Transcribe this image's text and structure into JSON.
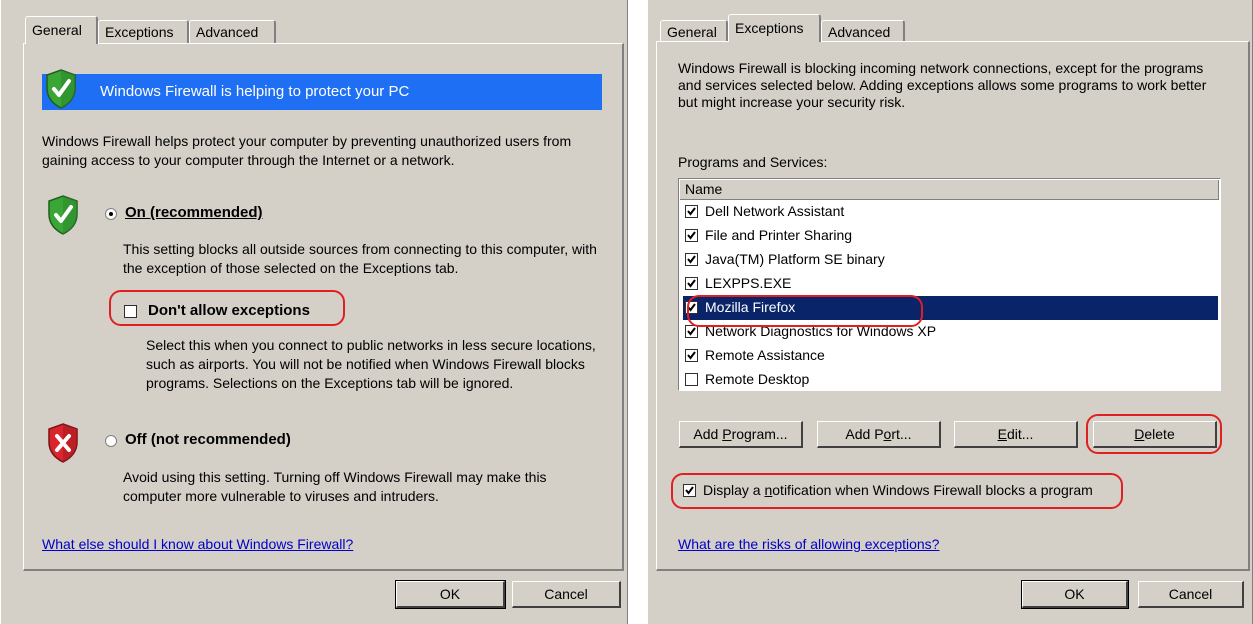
{
  "left": {
    "tabs": [
      "General",
      "Exceptions",
      "Advanced"
    ],
    "active_tab": "General",
    "banner": "Windows Firewall is helping to protect your PC",
    "intro": "Windows Firewall helps protect your computer by preventing unauthorized users from gaining access to your computer through the Internet or a network.",
    "on_label": "On (recommended)",
    "on_desc": "This setting blocks all outside sources from connecting to this computer, with the exception of those selected on the Exceptions tab.",
    "dont_allow_label": "Don't allow exceptions",
    "dont_allow_checked": false,
    "dont_allow_desc": "Select this when you connect to public networks in less secure locations, such as airports. You will not be notified when Windows Firewall blocks programs. Selections on the Exceptions tab will be ignored.",
    "off_label": "Off (not recommended)",
    "off_desc": "Avoid using this setting. Turning off Windows Firewall may make this computer more vulnerable to viruses and intruders.",
    "link": "What else should I know about Windows Firewall?",
    "ok": "OK",
    "cancel": "Cancel"
  },
  "right": {
    "tabs": [
      "General",
      "Exceptions",
      "Advanced"
    ],
    "active_tab": "Exceptions",
    "intro": "Windows Firewall is blocking incoming network connections, except for the programs and services selected below. Adding exceptions allows some programs to work better but might increase your security risk.",
    "programs_label": "Programs and Services:",
    "column_header": "Name",
    "programs": [
      {
        "name": "Dell Network Assistant",
        "checked": true
      },
      {
        "name": "File and Printer Sharing",
        "checked": true
      },
      {
        "name": "Java(TM) Platform SE binary",
        "checked": true
      },
      {
        "name": "LEXPPS.EXE",
        "checked": true
      },
      {
        "name": "Mozilla Firefox",
        "checked": true
      },
      {
        "name": "Network Diagnostics for Windows XP",
        "checked": true
      },
      {
        "name": "Remote Assistance",
        "checked": true
      },
      {
        "name": "Remote Desktop",
        "checked": false
      }
    ],
    "selected_program": "Mozilla Firefox",
    "add_program": "Add Program...",
    "add_port": "Add Port...",
    "edit": "Edit...",
    "delete": "Delete",
    "notify_label": "Display a notification when Windows Firewall blocks a program",
    "notify_checked": true,
    "link": "What are the risks of allowing exceptions?",
    "ok": "OK",
    "cancel": "Cancel"
  },
  "colors": {
    "dialog_bg": "#d4d0c8",
    "banner_blue": "#1e6ff3",
    "selection": "#0a246a",
    "highlight_red": "#e02020",
    "link": "#0000cc"
  }
}
